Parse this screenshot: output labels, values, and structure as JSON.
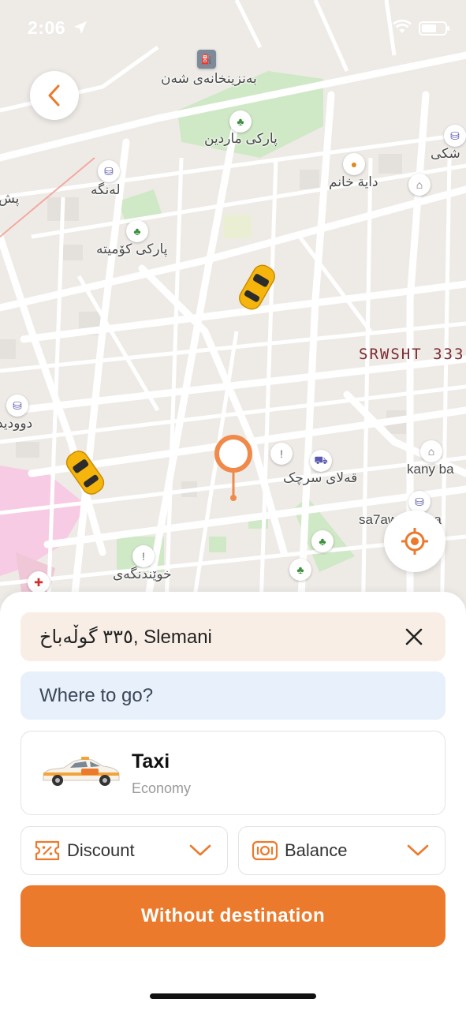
{
  "status_bar": {
    "time": "2:06"
  },
  "map": {
    "labels": {
      "gas_station": "بەنزینخانەی شەن",
      "park_mardin": "پارکی ماردین",
      "shop_langa": "لەنگە",
      "daya_xanm": "دایة خانم",
      "park_komita": "پارکی کۆمیتە",
      "shop_right": "شکی",
      "left_edge_top": "پش",
      "left_edge_mid": "دوودید",
      "qalay_srchk": "قەلای سرچک",
      "kany_ba": "kany ba",
      "sa7aw": "sa7aw shkara",
      "xwendngay": "خوێندنگەی",
      "srwsht": "SRWSHT 333"
    }
  },
  "sheet": {
    "pickup": {
      "value": "٣٣٥ گوڵەباخ, Slemani"
    },
    "destination": {
      "placeholder": "Where to go?"
    },
    "service": {
      "name": "Taxi",
      "tier": "Economy"
    },
    "discount_label": "Discount",
    "balance_label": "Balance",
    "cta_label": "Without destination"
  },
  "colors": {
    "accent": "#ec7a2c",
    "pickup_bg": "#f8eee6",
    "destination_bg": "#e7f0fb",
    "park": "#c8e6c0"
  }
}
